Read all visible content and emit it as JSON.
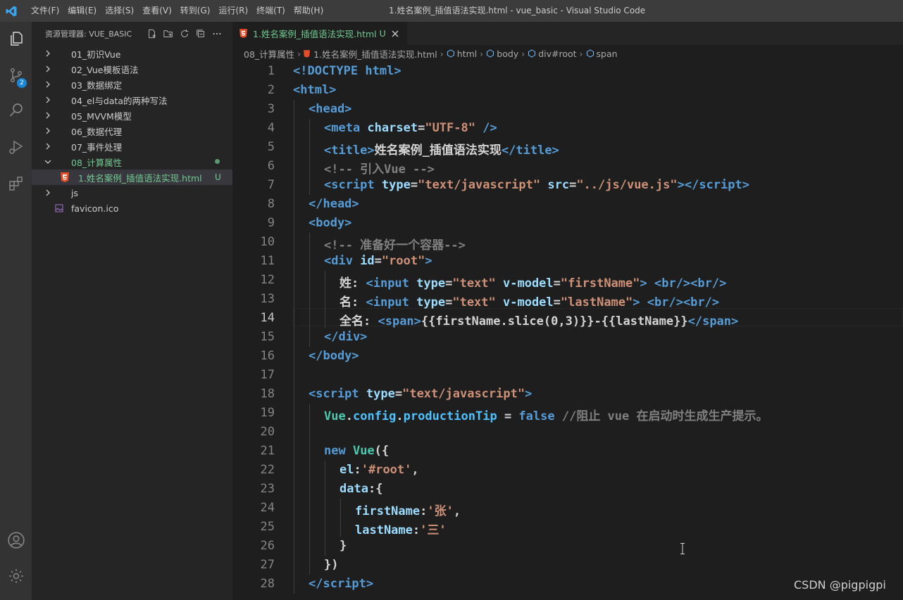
{
  "titlebar": {
    "menu": [
      "文件(F)",
      "编辑(E)",
      "选择(S)",
      "查看(V)",
      "转到(G)",
      "运行(R)",
      "终端(T)",
      "帮助(H)"
    ],
    "title": "1.姓名案例_插值语法实现.html - vue_basic - Visual Studio Code"
  },
  "activity": {
    "scm_badge": "2"
  },
  "sidebar": {
    "header": "资源管理器: VUE_BASIC",
    "items": [
      {
        "label": "01_初识Vue"
      },
      {
        "label": "02_Vue模板语法"
      },
      {
        "label": "03_数据绑定"
      },
      {
        "label": "04_el与data的两种写法"
      },
      {
        "label": "05_MVVM模型"
      },
      {
        "label": "06_数据代理"
      },
      {
        "label": "07_事件处理"
      },
      {
        "label": "08_计算属性"
      },
      {
        "label": "1.姓名案例_插值语法实现.html",
        "status": "U"
      },
      {
        "label": "js"
      },
      {
        "label": "favicon.ico"
      }
    ]
  },
  "editor": {
    "tab": {
      "label": "1.姓名案例_插值语法实现.html",
      "status": "U"
    },
    "breadcrumbs": [
      "08_计算属性",
      "1.姓名案例_插值语法实现.html",
      "html",
      "body",
      "div#root",
      "span"
    ],
    "line_numbers": [
      "1",
      "2",
      "3",
      "4",
      "5",
      "6",
      "7",
      "8",
      "9",
      "10",
      "11",
      "12",
      "13",
      "14",
      "15",
      "16",
      "17",
      "18",
      "19",
      "20",
      "21",
      "22",
      "23",
      "24",
      "25",
      "26",
      "27",
      "28"
    ],
    "current_line": "14"
  },
  "watermark": "CSDN @pigpigpi",
  "colors": {
    "tag": "#569cd6",
    "attr_name": "#9cdcfe",
    "attr_value": "#ce9178",
    "comment": "#6a9955",
    "untracked": "#73c991"
  }
}
